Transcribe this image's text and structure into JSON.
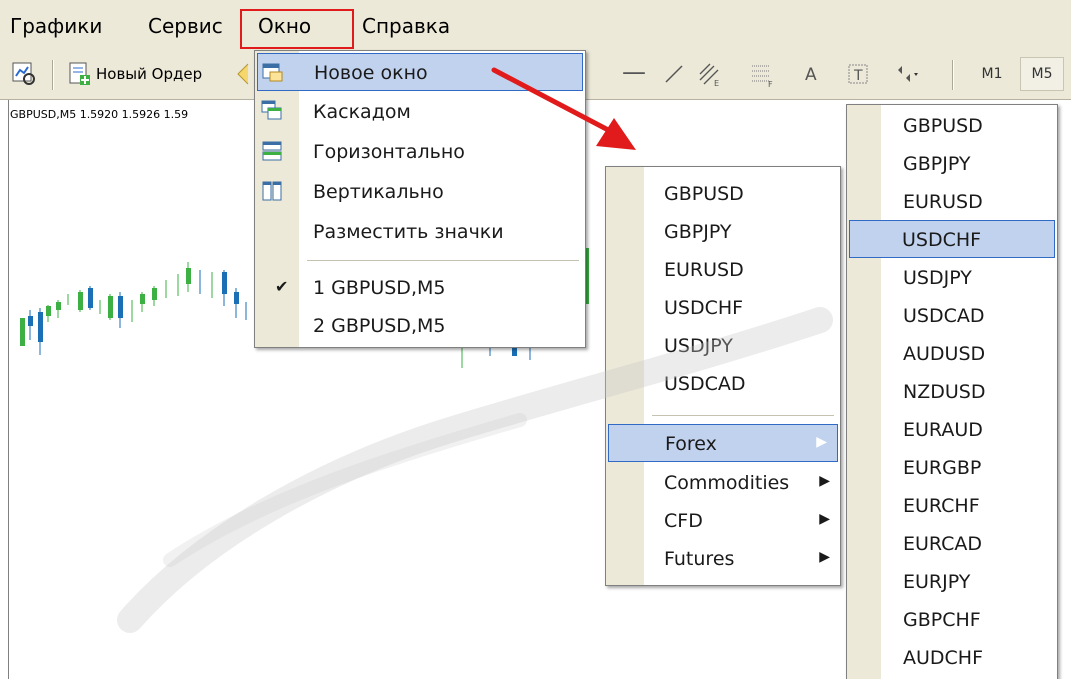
{
  "menubar": {
    "items": [
      "Графики",
      "Сервис",
      "Окно",
      "Справка"
    ]
  },
  "toolbar": {
    "new_order_label": "Новый Ордер",
    "timeframes": [
      "M1",
      "M5"
    ]
  },
  "chart": {
    "info_label": "GBPUSD,M5  1.5920 1.5926 1.59"
  },
  "window_menu": {
    "items": [
      {
        "label": "Новое окно",
        "icon": "new-window-icon"
      },
      {
        "label": "Каскадом",
        "icon": "cascade-icon"
      },
      {
        "label": "Горизонтально",
        "icon": "tile-horizontal-icon"
      },
      {
        "label": "Вертикально",
        "icon": "tile-vertical-icon"
      },
      {
        "label": "Разместить значки",
        "icon": ""
      }
    ],
    "windows": [
      {
        "label": "1 GBPUSD,M5",
        "checked": true
      },
      {
        "label": "2 GBPUSD,M5",
        "checked": false
      }
    ]
  },
  "symbols_menu": {
    "symbols": [
      "GBPUSD",
      "GBPJPY",
      "EURUSD",
      "USDCHF",
      "USDJPY",
      "USDCAD"
    ],
    "groups": [
      "Forex",
      "Commodities",
      "CFD",
      "Futures"
    ]
  },
  "forex_menu": {
    "symbols": [
      "GBPUSD",
      "GBPJPY",
      "EURUSD",
      "USDCHF",
      "USDJPY",
      "USDCAD",
      "AUDUSD",
      "NZDUSD",
      "EURAUD",
      "EURGBP",
      "EURCHF",
      "EURCAD",
      "EURJPY",
      "GBPCHF",
      "AUDCHF"
    ]
  },
  "colors": {
    "highlight": "#c1d2ee",
    "highlight_border": "#316ac5",
    "annotation": "#e11b1b",
    "bull_candle": "#3cb043",
    "bear_candle": "#1a6fb5"
  }
}
